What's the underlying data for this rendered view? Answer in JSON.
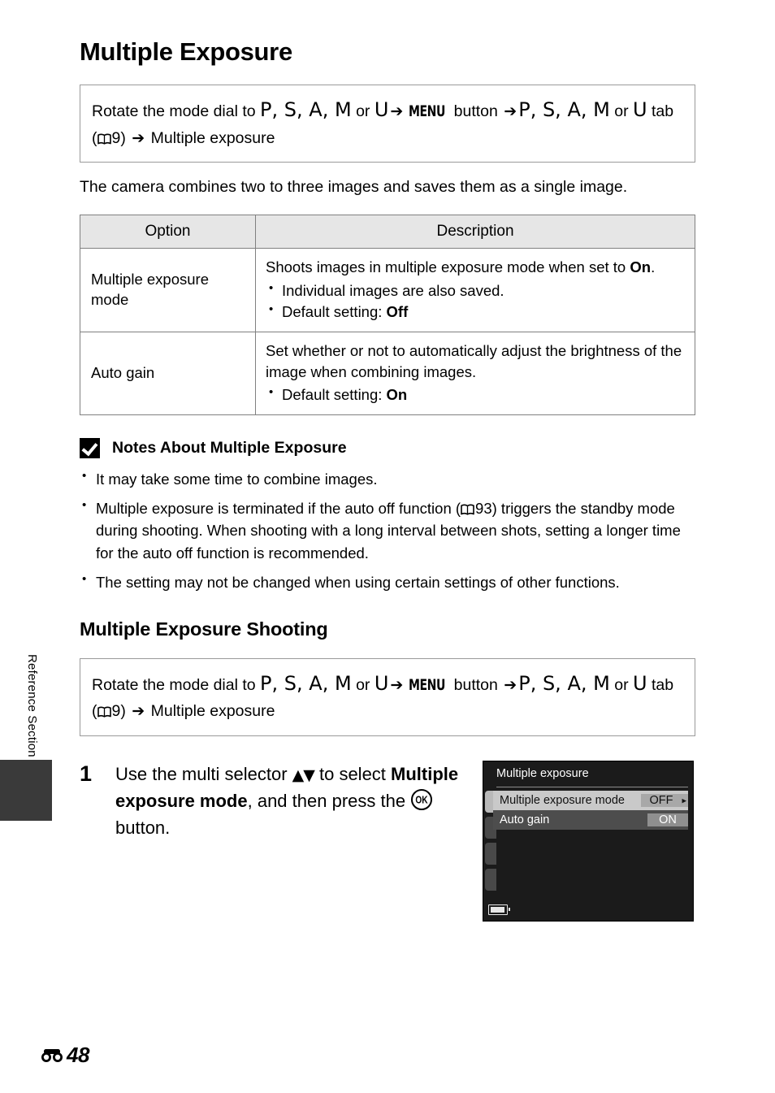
{
  "sidebar": {
    "section_label": "Reference Section"
  },
  "header": {
    "title": "Multiple Exposure"
  },
  "nav_path_1": {
    "prefix": "Rotate the mode dial to ",
    "modes_1": "P, S, A, M",
    "or_1": " or ",
    "mode_u_1": "U",
    "menu_label": "MENU",
    "button_word": " button ",
    "modes_2": "P, S, A, M",
    "or_2": " or",
    "mode_u_2": "U",
    "tab_word": " tab (",
    "page_ref": "9",
    "close_paren": ") ",
    "destination": " Multiple exposure",
    "arrow": "➔"
  },
  "intro": "The camera combines two to three images and saves them as a single image.",
  "table": {
    "headers": [
      "Option",
      "Description"
    ],
    "rows": [
      {
        "option": "Multiple exposure mode",
        "description_lead_a": "Shoots images in multiple exposure mode when set to ",
        "description_lead_bold": "On",
        "description_lead_b": ".",
        "bullets": [
          {
            "text_a": "Individual images are also saved.",
            "bold": "",
            "text_b": ""
          },
          {
            "text_a": "Default setting: ",
            "bold": "Off",
            "text_b": ""
          }
        ]
      },
      {
        "option": "Auto gain",
        "description_lead_a": "Set whether or not to automatically adjust the brightness of the image when combining images.",
        "description_lead_bold": "",
        "description_lead_b": "",
        "bullets": [
          {
            "text_a": "Default setting: ",
            "bold": "On",
            "text_b": ""
          }
        ]
      }
    ]
  },
  "notes": {
    "title": "Notes About Multiple Exposure",
    "bullets": [
      {
        "text_a": "It may take some time to combine images.",
        "page_ref": "",
        "text_b": ""
      },
      {
        "text_a": "Multiple exposure is terminated if the auto off function (",
        "page_ref": "93",
        "text_b": ") triggers the standby mode during shooting. When shooting with a long interval between shots, setting a longer time for the auto off function is recommended."
      },
      {
        "text_a": "The setting may not be changed when using certain settings of other functions.",
        "page_ref": "",
        "text_b": ""
      }
    ]
  },
  "subsection": {
    "title": "Multiple Exposure Shooting"
  },
  "nav_path_2": {
    "prefix": "Rotate the mode dial to ",
    "modes_1": "P, S, A, M",
    "or_1": " or ",
    "mode_u_1": "U",
    "menu_label": "MENU",
    "button_word": " button ",
    "modes_2": "P, S, A, M",
    "or_2": " or",
    "mode_u_2": "U",
    "tab_word": " tab (",
    "page_ref": "9",
    "close_paren": ") ",
    "destination": " Multiple exposure",
    "arrow": "➔"
  },
  "step": {
    "number": "1",
    "text_a": "Use the multi selector ",
    "arrows": "▲▼",
    "text_b": " to select ",
    "bold": "Multiple exposure mode",
    "text_c": ", and then press the ",
    "ok_label": "OK",
    "text_d": " button."
  },
  "lcd": {
    "title": "Multiple exposure",
    "rows": [
      {
        "label": "Multiple exposure mode",
        "value": "OFF",
        "selected": true
      },
      {
        "label": "Auto gain",
        "value": "ON",
        "selected": false
      }
    ],
    "caret": "▸"
  },
  "footer": {
    "page_number": "48"
  },
  "colors": {
    "table_header_bg": "#e6e6e6",
    "table_border": "#808080",
    "lcd_bg": "#1b1b1b",
    "lcd_selected_bg": "#c9c9c9",
    "lcd_unselected_bg": "#4d4d4d",
    "side_tab": "#3a3a3a"
  }
}
